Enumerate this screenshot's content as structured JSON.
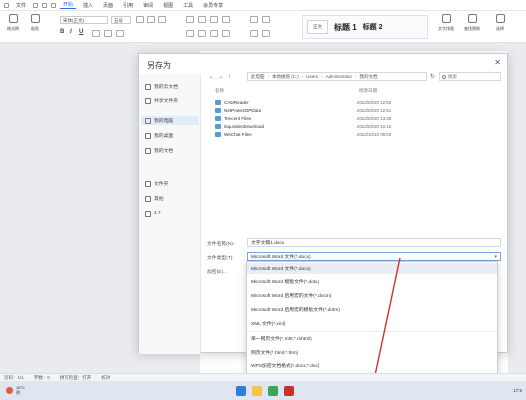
{
  "menubar": {
    "items": [
      "文件",
      "开始",
      "插入",
      "页面",
      "引用",
      "审阅",
      "视图",
      "工具",
      "会员专享"
    ],
    "active_index": 1
  },
  "ribbon": {
    "buttons": [
      "格式刷",
      "粘贴",
      "剪切",
      "复制"
    ],
    "font_name": "宋体(正文)",
    "font_size": "五号",
    "style_normal": "正文",
    "style_h1": "标题 1",
    "style_h2": "标题 2",
    "right_buttons": [
      "文字排版",
      "查找替换",
      "选择"
    ]
  },
  "dialog": {
    "title": "另存为",
    "close_glyph": "✕",
    "sidebar": {
      "items": [
        {
          "label": "我的云文档",
          "icon": "cloud-icon"
        },
        {
          "label": "共享文件夹",
          "icon": "share-folder-icon"
        },
        {
          "label": "我的电脑",
          "icon": "computer-icon"
        },
        {
          "label": "我的桌面",
          "icon": "desktop-icon"
        },
        {
          "label": "我的文档",
          "icon": "documents-icon"
        },
        {
          "label": "文件夹",
          "icon": "folder-icon"
        },
        {
          "label": "其他",
          "icon": "folder-icon"
        },
        {
          "label": "4.7",
          "icon": "folder-icon"
        }
      ],
      "active_index": 2
    },
    "nav": {
      "back": "←",
      "forward": "→",
      "up": "↑",
      "breadcrumbs": [
        "此电脑",
        "本地磁盘 (C:)",
        "Users",
        "Administrator",
        "我的文档"
      ],
      "refresh": "↻",
      "search_placeholder": "搜索"
    },
    "list": {
      "col_name": "名称",
      "col_date": "修改日期",
      "files": [
        {
          "name": "CADReader",
          "date": "2023/03/20 12:52"
        },
        {
          "name": "NetPowerZIPData",
          "date": "2023/03/20 12:51"
        },
        {
          "name": "Tencent Files",
          "date": "2023/03/20 13:28"
        },
        {
          "name": "tsquvideoDownload",
          "date": "2023/03/20 10:15"
        },
        {
          "name": "WeChat Files",
          "date": "2023/10/10 09:03"
        }
      ]
    },
    "filename_label": "文件名称(N):",
    "filename_value": "文字文稿1.docx",
    "filetype_label": "文件类型(T):",
    "filetype_value": "Microsoft Word 文件(*.docx)",
    "encrypt_label": "加密(E)..."
  },
  "dropdown": {
    "items": [
      "Microsoft Word 文件(*.docx)",
      "Microsoft Word 模板文件(*.dotx)",
      "Microsoft Word 启用宏的文件(*.docm)",
      "Microsoft Word 启用宏的模板文件(*.dotm)",
      "XML 文件(*.xml)",
      "单一网页文件(*.mht;*.mhtml)",
      "网页文件(*.html;*.htm)",
      "WPS加密文档格式(*.docx;*.doc)",
      "Word XML 文档(*.xml)",
      "PDF 文件格式(*.pdf)"
    ],
    "highlight_index": 0,
    "selected_index": 9
  },
  "statusbar": {
    "items": [
      "页码：1/1",
      "字数：0",
      "拼写检查：打开",
      "校对"
    ]
  },
  "taskbar": {
    "weather_temp": "16°C",
    "weather_desc": "阴",
    "clock": "17:5"
  },
  "colors": {
    "accent": "#2a6fdb",
    "highlight_box": "#d32f2f",
    "folder": "#5b9bd5"
  }
}
